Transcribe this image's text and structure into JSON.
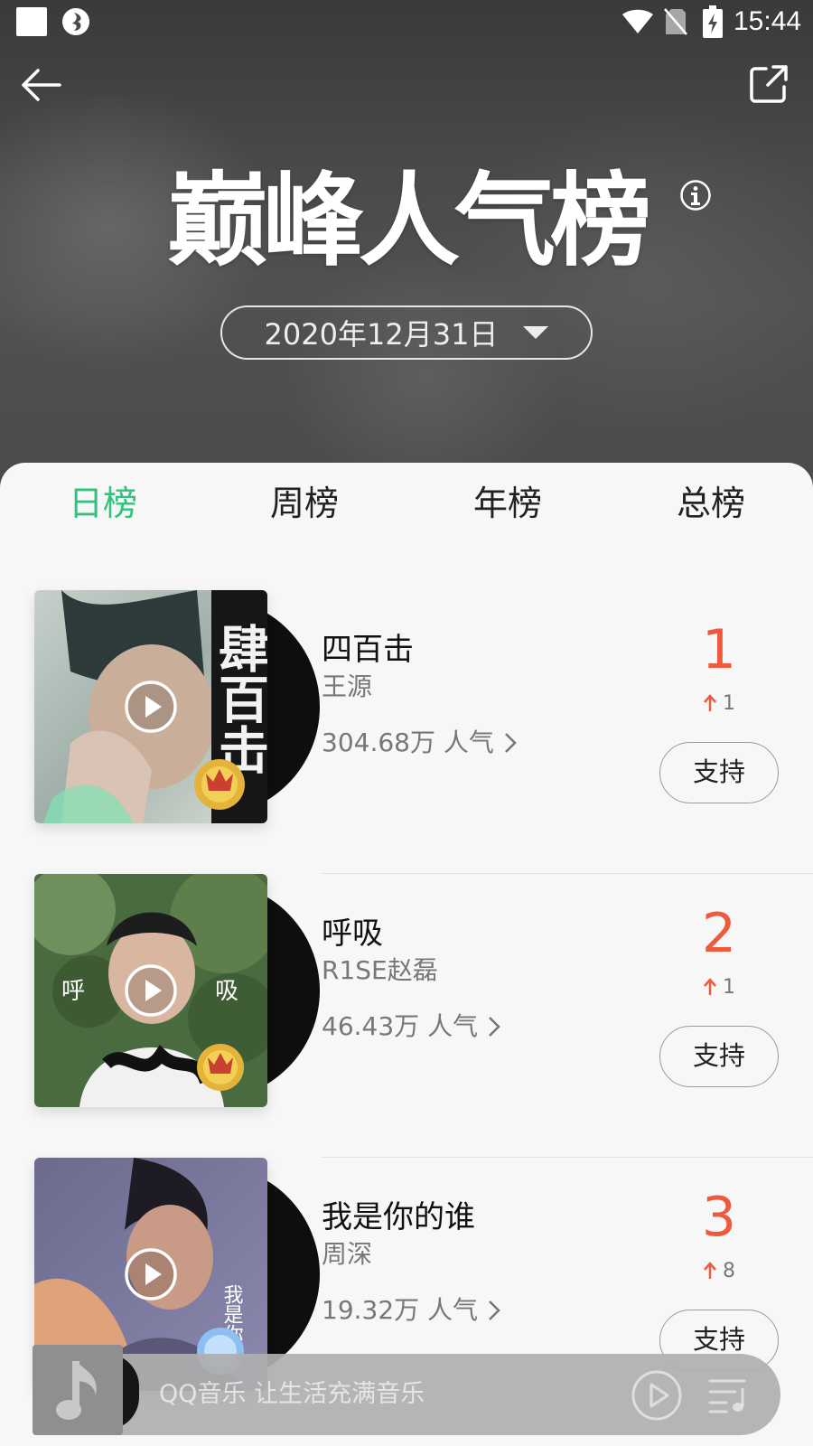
{
  "status_bar": {
    "time": "15:44",
    "icons": [
      "notification-square-icon",
      "qq-music-app-icon",
      "wifi-icon",
      "no-sim-icon",
      "battery-charging-icon"
    ]
  },
  "header": {
    "back_icon": "arrow-left-icon",
    "share_icon": "share-external-icon",
    "title": "巅峰人气榜",
    "info_icon": "info-circle-icon",
    "date": "2020年12月31日"
  },
  "tabs": [
    {
      "label": "日榜",
      "active": true
    },
    {
      "label": "周榜",
      "active": false
    },
    {
      "label": "年榜",
      "active": false
    },
    {
      "label": "总榜",
      "active": false
    }
  ],
  "songs": [
    {
      "title": "四百击",
      "artist": "王源",
      "popularity": "304.68万 人气",
      "rank": "1",
      "change": "1",
      "button": "支持"
    },
    {
      "title": "呼吸",
      "artist": "R1SE赵磊",
      "popularity": "46.43万 人气",
      "rank": "2",
      "change": "1",
      "button": "支持"
    },
    {
      "title": "我是你的谁",
      "artist": "周深",
      "popularity": "19.32万 人气",
      "rank": "3",
      "change": "8",
      "button": "支持"
    }
  ],
  "cover_text": {
    "song1": "肆百击",
    "song2_left": "呼",
    "song2_right": "吸",
    "song3": "我是你的"
  },
  "mini_player": {
    "text": "QQ音乐 让生活充满音乐"
  },
  "colors": {
    "accent_green": "#31c27c",
    "rank_red": "#ef5a3c"
  }
}
